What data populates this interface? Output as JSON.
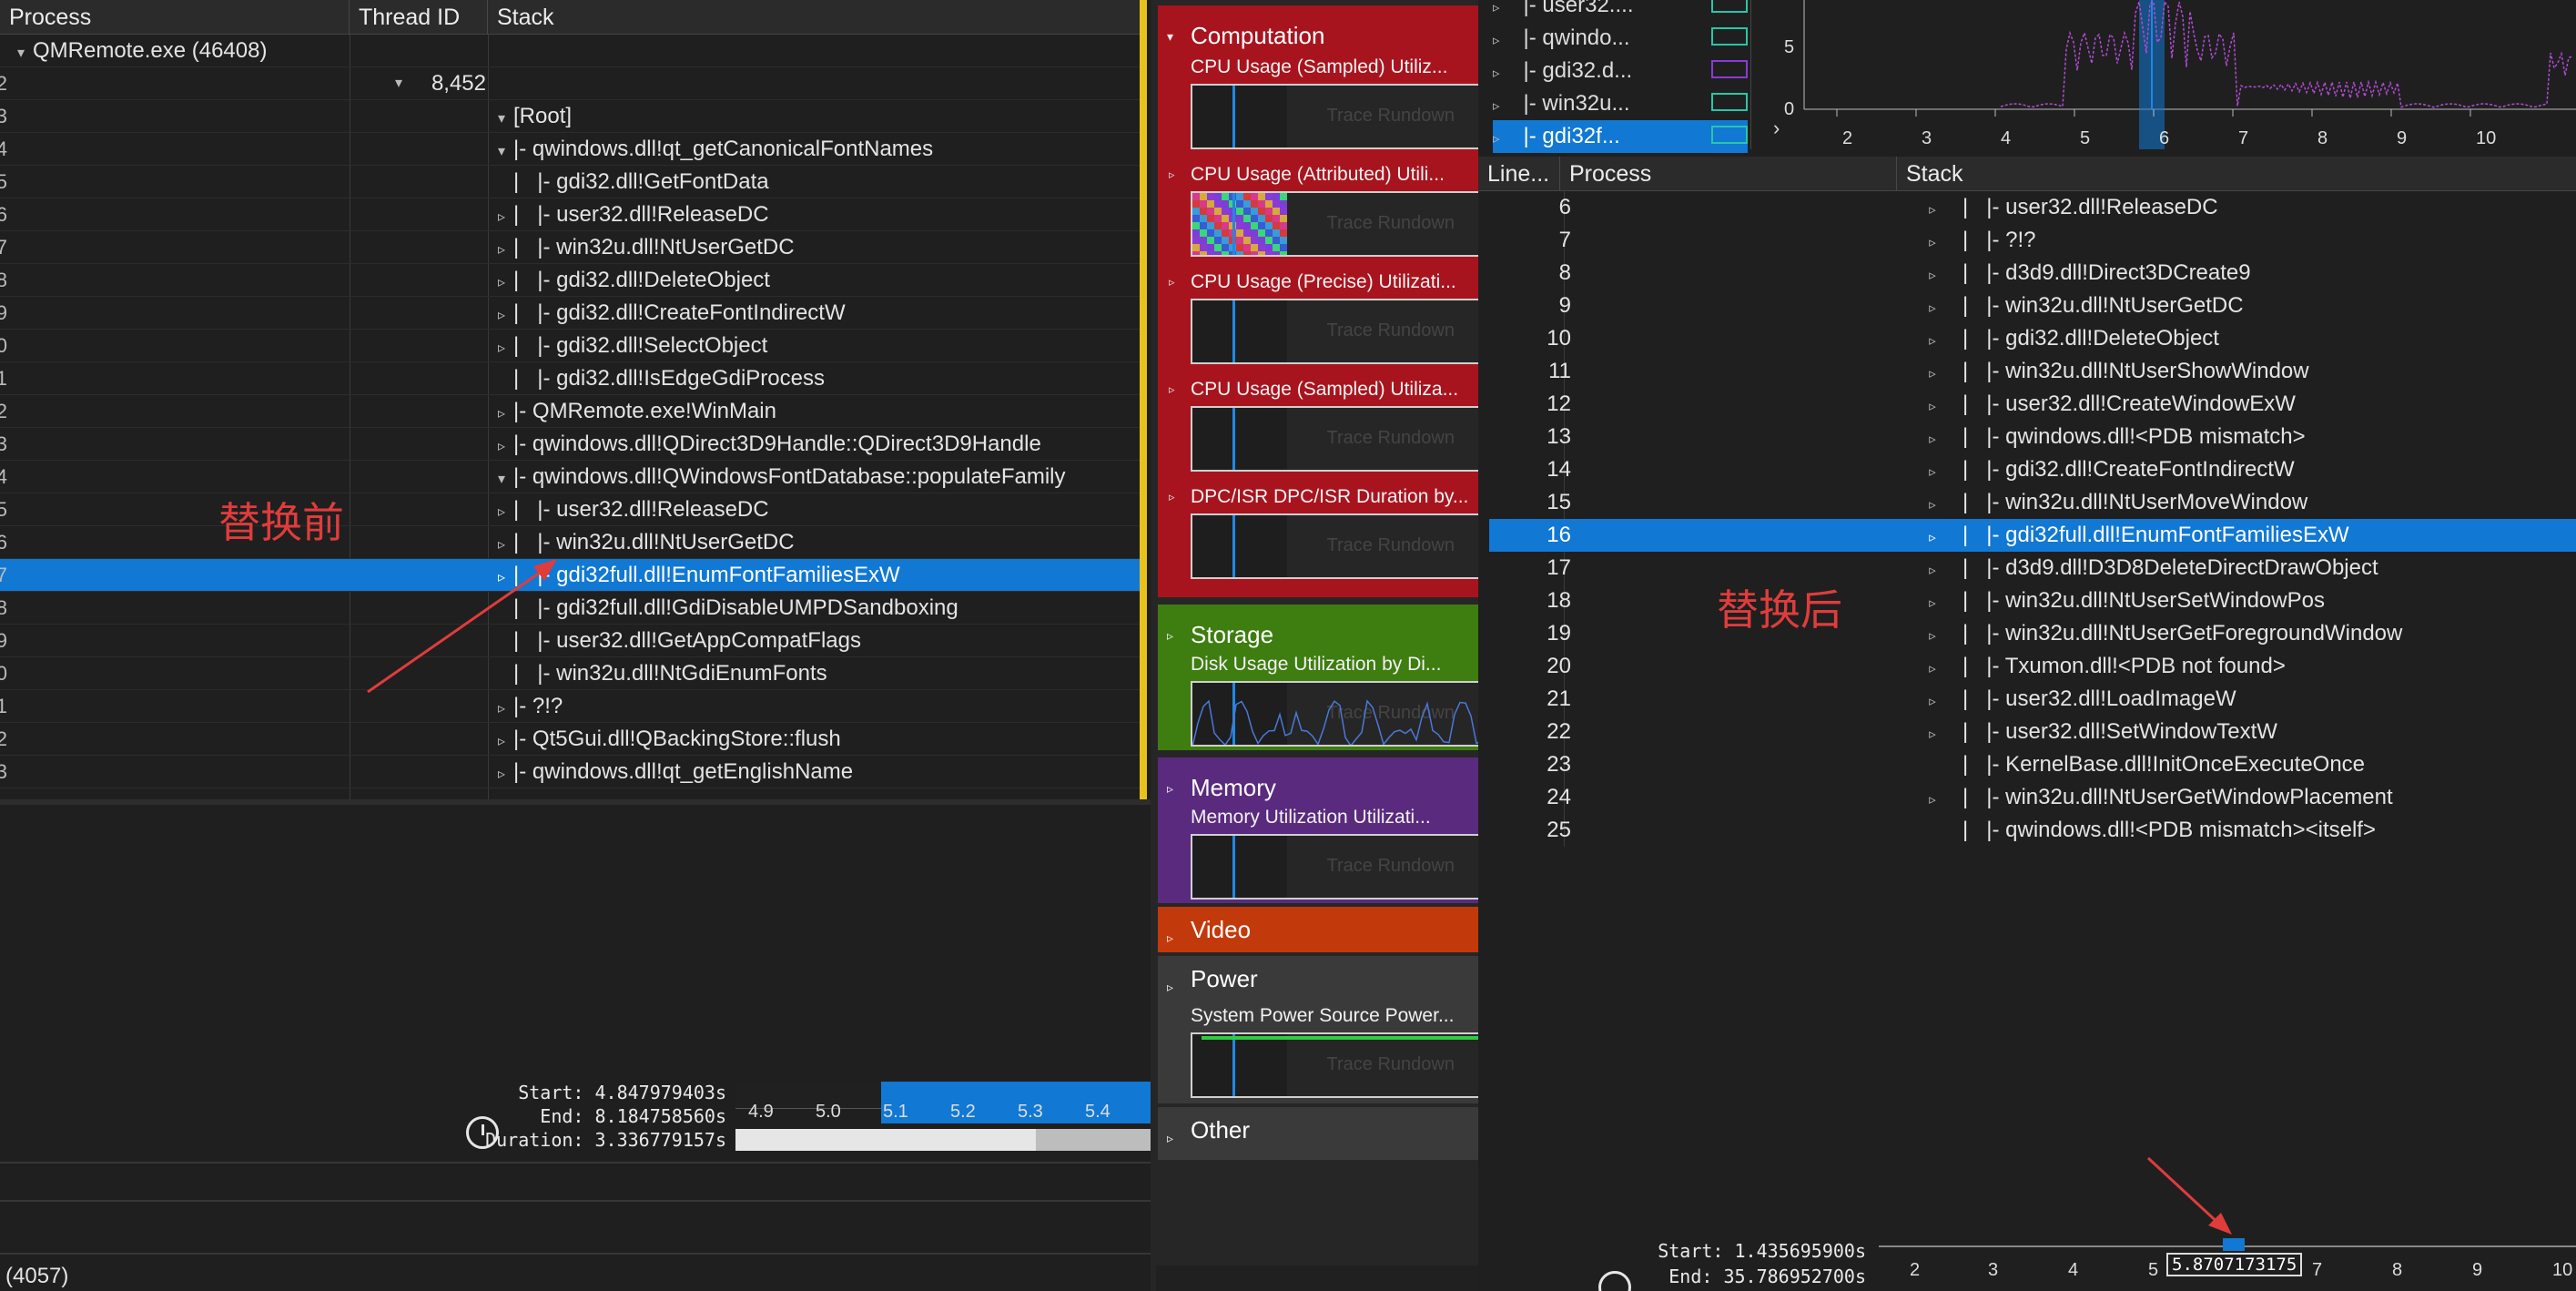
{
  "left": {
    "headers": {
      "process": "Process",
      "thread_id": "Thread ID",
      "stack": "Stack"
    },
    "rows": [
      {
        "n": "",
        "proc": "QMRemote.exe (46408)",
        "tid": "",
        "tri": "▾",
        "indent": "",
        "stack": ""
      },
      {
        "n": "2",
        "proc": "",
        "tid": "8,452",
        "tri": "",
        "indent": "",
        "stack": ""
      },
      {
        "n": "3",
        "proc": "",
        "tid": "",
        "tri": "▾",
        "indent": "",
        "stack": "[Root]"
      },
      {
        "n": "4",
        "proc": "",
        "tid": "",
        "tri": "▾",
        "indent": "",
        "stack": "|- qwindows.dll!qt_getCanonicalFontNames"
      },
      {
        "n": "5",
        "proc": "",
        "tid": "",
        "tri": "",
        "indent": "|   ",
        "stack": "|- gdi32.dll!GetFontData"
      },
      {
        "n": "6",
        "proc": "",
        "tid": "",
        "tri": "▹",
        "indent": "|   ",
        "stack": "|- user32.dll!ReleaseDC"
      },
      {
        "n": "7",
        "proc": "",
        "tid": "",
        "tri": "▹",
        "indent": "|   ",
        "stack": "|- win32u.dll!NtUserGetDC"
      },
      {
        "n": "8",
        "proc": "",
        "tid": "",
        "tri": "▹",
        "indent": "|   ",
        "stack": "|- gdi32.dll!DeleteObject"
      },
      {
        "n": "9",
        "proc": "",
        "tid": "",
        "tri": "▹",
        "indent": "|   ",
        "stack": "|- gdi32.dll!CreateFontIndirectW"
      },
      {
        "n": "0",
        "proc": "",
        "tid": "",
        "tri": "▹",
        "indent": "|   ",
        "stack": "|- gdi32.dll!SelectObject"
      },
      {
        "n": "1",
        "proc": "",
        "tid": "",
        "tri": "",
        "indent": "|   ",
        "stack": "|- gdi32.dll!IsEdgeGdiProcess"
      },
      {
        "n": "2",
        "proc": "",
        "tid": "",
        "tri": "▹",
        "indent": "",
        "stack": "|- QMRemote.exe!WinMain"
      },
      {
        "n": "3",
        "proc": "",
        "tid": "",
        "tri": "▹",
        "indent": "",
        "stack": "|- qwindows.dll!QDirect3D9Handle::QDirect3D9Handle"
      },
      {
        "n": "4",
        "proc": "",
        "tid": "",
        "tri": "▾",
        "indent": "",
        "stack": "|- qwindows.dll!QWindowsFontDatabase::populateFamily"
      },
      {
        "n": "5",
        "proc": "",
        "tid": "",
        "tri": "▹",
        "indent": "|   ",
        "stack": "|- user32.dll!ReleaseDC"
      },
      {
        "n": "6",
        "proc": "",
        "tid": "",
        "tri": "▹",
        "indent": "|   ",
        "stack": "|- win32u.dll!NtUserGetDC"
      },
      {
        "n": "7",
        "proc": "",
        "tid": "",
        "tri": "▹",
        "indent": "|   ",
        "stack": "|- gdi32full.dll!EnumFontFamiliesExW",
        "sel": true
      },
      {
        "n": "8",
        "proc": "",
        "tid": "",
        "tri": "",
        "indent": "|   ",
        "stack": "|- gdi32full.dll!GdiDisableUMPDSandboxing"
      },
      {
        "n": "9",
        "proc": "",
        "tid": "",
        "tri": "",
        "indent": "|   ",
        "stack": "|- user32.dll!GetAppCompatFlags"
      },
      {
        "n": "0",
        "proc": "",
        "tid": "",
        "tri": "",
        "indent": "|   ",
        "stack": "|- win32u.dll!NtGdiEnumFonts"
      },
      {
        "n": "1",
        "proc": "",
        "tid": "",
        "tri": "▹",
        "indent": "",
        "stack": "|- ?!?"
      },
      {
        "n": "2",
        "proc": "",
        "tid": "",
        "tri": "▹",
        "indent": "",
        "stack": "|- Qt5Gui.dll!QBackingStore::flush"
      },
      {
        "n": "3",
        "proc": "",
        "tid": "",
        "tri": "▹",
        "indent": "",
        "stack": "|- qwindows.dll!qt_getEnglishName"
      }
    ],
    "annotation": "替换前",
    "timeline": {
      "start": "Start: 4.847979403s",
      "end": "End: 8.184758560s",
      "duration": "Duration: 3.336779157s",
      "ticks": [
        "4.9",
        "5.0",
        "5.1",
        "5.2",
        "5.3",
        "5.4"
      ]
    },
    "status": "(4057)"
  },
  "graph_explorer": {
    "categories": [
      {
        "title": "Computation",
        "color": "#a8141e",
        "subs": [
          {
            "label": "CPU Usage (Sampled)    Utiliz...",
            "thumb_text": "Trace Rundown",
            "expanded": true
          },
          {
            "label": "CPU Usage (Attributed)    Utili...",
            "thumb_text": "Trace Rundown",
            "expanded": false
          },
          {
            "label": "CPU Usage (Precise)    Utilizati...",
            "thumb_text": "Trace Rundown",
            "expanded": false
          },
          {
            "label": "CPU Usage (Sampled)    Utiliza...",
            "thumb_text": "Trace Rundown",
            "expanded": false
          },
          {
            "label": "DPC/ISR    DPC/ISR Duration by...",
            "thumb_text": "Trace Rundown",
            "expanded": false
          }
        ]
      },
      {
        "title": "Storage",
        "color": "#3e7d10",
        "subs": [
          {
            "label": "Disk Usage    Utilization by Di...",
            "thumb_text": "Trace Rundown"
          }
        ]
      },
      {
        "title": "Memory",
        "color": "#5a2a7e",
        "subs": [
          {
            "label": "Memory Utilization    Utilizati...",
            "thumb_text": "Trace Rundown"
          }
        ]
      },
      {
        "title": "Video",
        "color": "#c23a0c",
        "subs": []
      },
      {
        "title": "Power",
        "color": "#3a3a3a",
        "subs": [
          {
            "label": "System Power Source    Power...",
            "thumb_text": "Trace Rundown"
          }
        ]
      },
      {
        "title": "Other",
        "color": "#3a3a3a",
        "subs": []
      }
    ]
  },
  "right": {
    "top_list": [
      {
        "label": "|- user32....",
        "sel": false
      },
      {
        "label": "|- qwindo...",
        "sel": false
      },
      {
        "label": "|- gdi32.d...",
        "sel": false
      },
      {
        "label": "|- win32u...",
        "sel": false
      },
      {
        "label": "|- gdi32f...",
        "sel": true
      }
    ],
    "minichart": {
      "y_ticks": [
        "5",
        "0"
      ],
      "x_ticks": [
        "2",
        "3",
        "4",
        "5",
        "6",
        "7",
        "8",
        "9",
        "10"
      ]
    },
    "headers": {
      "line": "Line...",
      "process": "Process",
      "stack": "Stack"
    },
    "rows": [
      {
        "ln": "6",
        "tri": "▹",
        "stack": "|- user32.dll!ReleaseDC"
      },
      {
        "ln": "7",
        "tri": "▹",
        "stack": "|- ?!?"
      },
      {
        "ln": "8",
        "tri": "▹",
        "stack": "|- d3d9.dll!Direct3DCreate9"
      },
      {
        "ln": "9",
        "tri": "▹",
        "stack": "|- win32u.dll!NtUserGetDC"
      },
      {
        "ln": "10",
        "tri": "▹",
        "stack": "|- gdi32.dll!DeleteObject"
      },
      {
        "ln": "11",
        "tri": "▹",
        "stack": "|- win32u.dll!NtUserShowWindow"
      },
      {
        "ln": "12",
        "tri": "▹",
        "stack": "|- user32.dll!CreateWindowExW"
      },
      {
        "ln": "13",
        "tri": "▹",
        "stack": "|- qwindows.dll!<PDB mismatch>"
      },
      {
        "ln": "14",
        "tri": "▹",
        "stack": "|- gdi32.dll!CreateFontIndirectW"
      },
      {
        "ln": "15",
        "tri": "▹",
        "stack": "|- win32u.dll!NtUserMoveWindow"
      },
      {
        "ln": "16",
        "tri": "▹",
        "stack": "|- gdi32full.dll!EnumFontFamiliesExW",
        "sel": true
      },
      {
        "ln": "17",
        "tri": "▹",
        "stack": "|- d3d9.dll!D3D8DeleteDirectDrawObject"
      },
      {
        "ln": "18",
        "tri": "▹",
        "stack": "|- win32u.dll!NtUserSetWindowPos"
      },
      {
        "ln": "19",
        "tri": "▹",
        "stack": "|- win32u.dll!NtUserGetForegroundWindow"
      },
      {
        "ln": "20",
        "tri": "▹",
        "stack": "|- Txumon.dll!<PDB not found>"
      },
      {
        "ln": "21",
        "tri": "▹",
        "stack": "|- user32.dll!LoadImageW"
      },
      {
        "ln": "22",
        "tri": "▹",
        "stack": "|- user32.dll!SetWindowTextW"
      },
      {
        "ln": "23",
        "tri": "",
        "stack": "|- KernelBase.dll!InitOnceExecuteOnce"
      },
      {
        "ln": "24",
        "tri": "▹",
        "stack": "|- win32u.dll!NtUserGetWindowPlacement"
      },
      {
        "ln": "25",
        "tri": "",
        "stack": "|- qwindows.dll!<PDB mismatch><itself>"
      }
    ],
    "annotation": "替换后",
    "timeline": {
      "start": "Start: 1.435695900s",
      "end": "End: 35.786952700s",
      "tooltip": "5.8707173175",
      "ticks": [
        "2",
        "3",
        "4",
        "5",
        "7",
        "8",
        "9",
        "10"
      ]
    }
  },
  "colors": {
    "selection": "#1178d4",
    "accent_yellow": "#e8c21c",
    "annotation_red": "#e03c3c"
  }
}
